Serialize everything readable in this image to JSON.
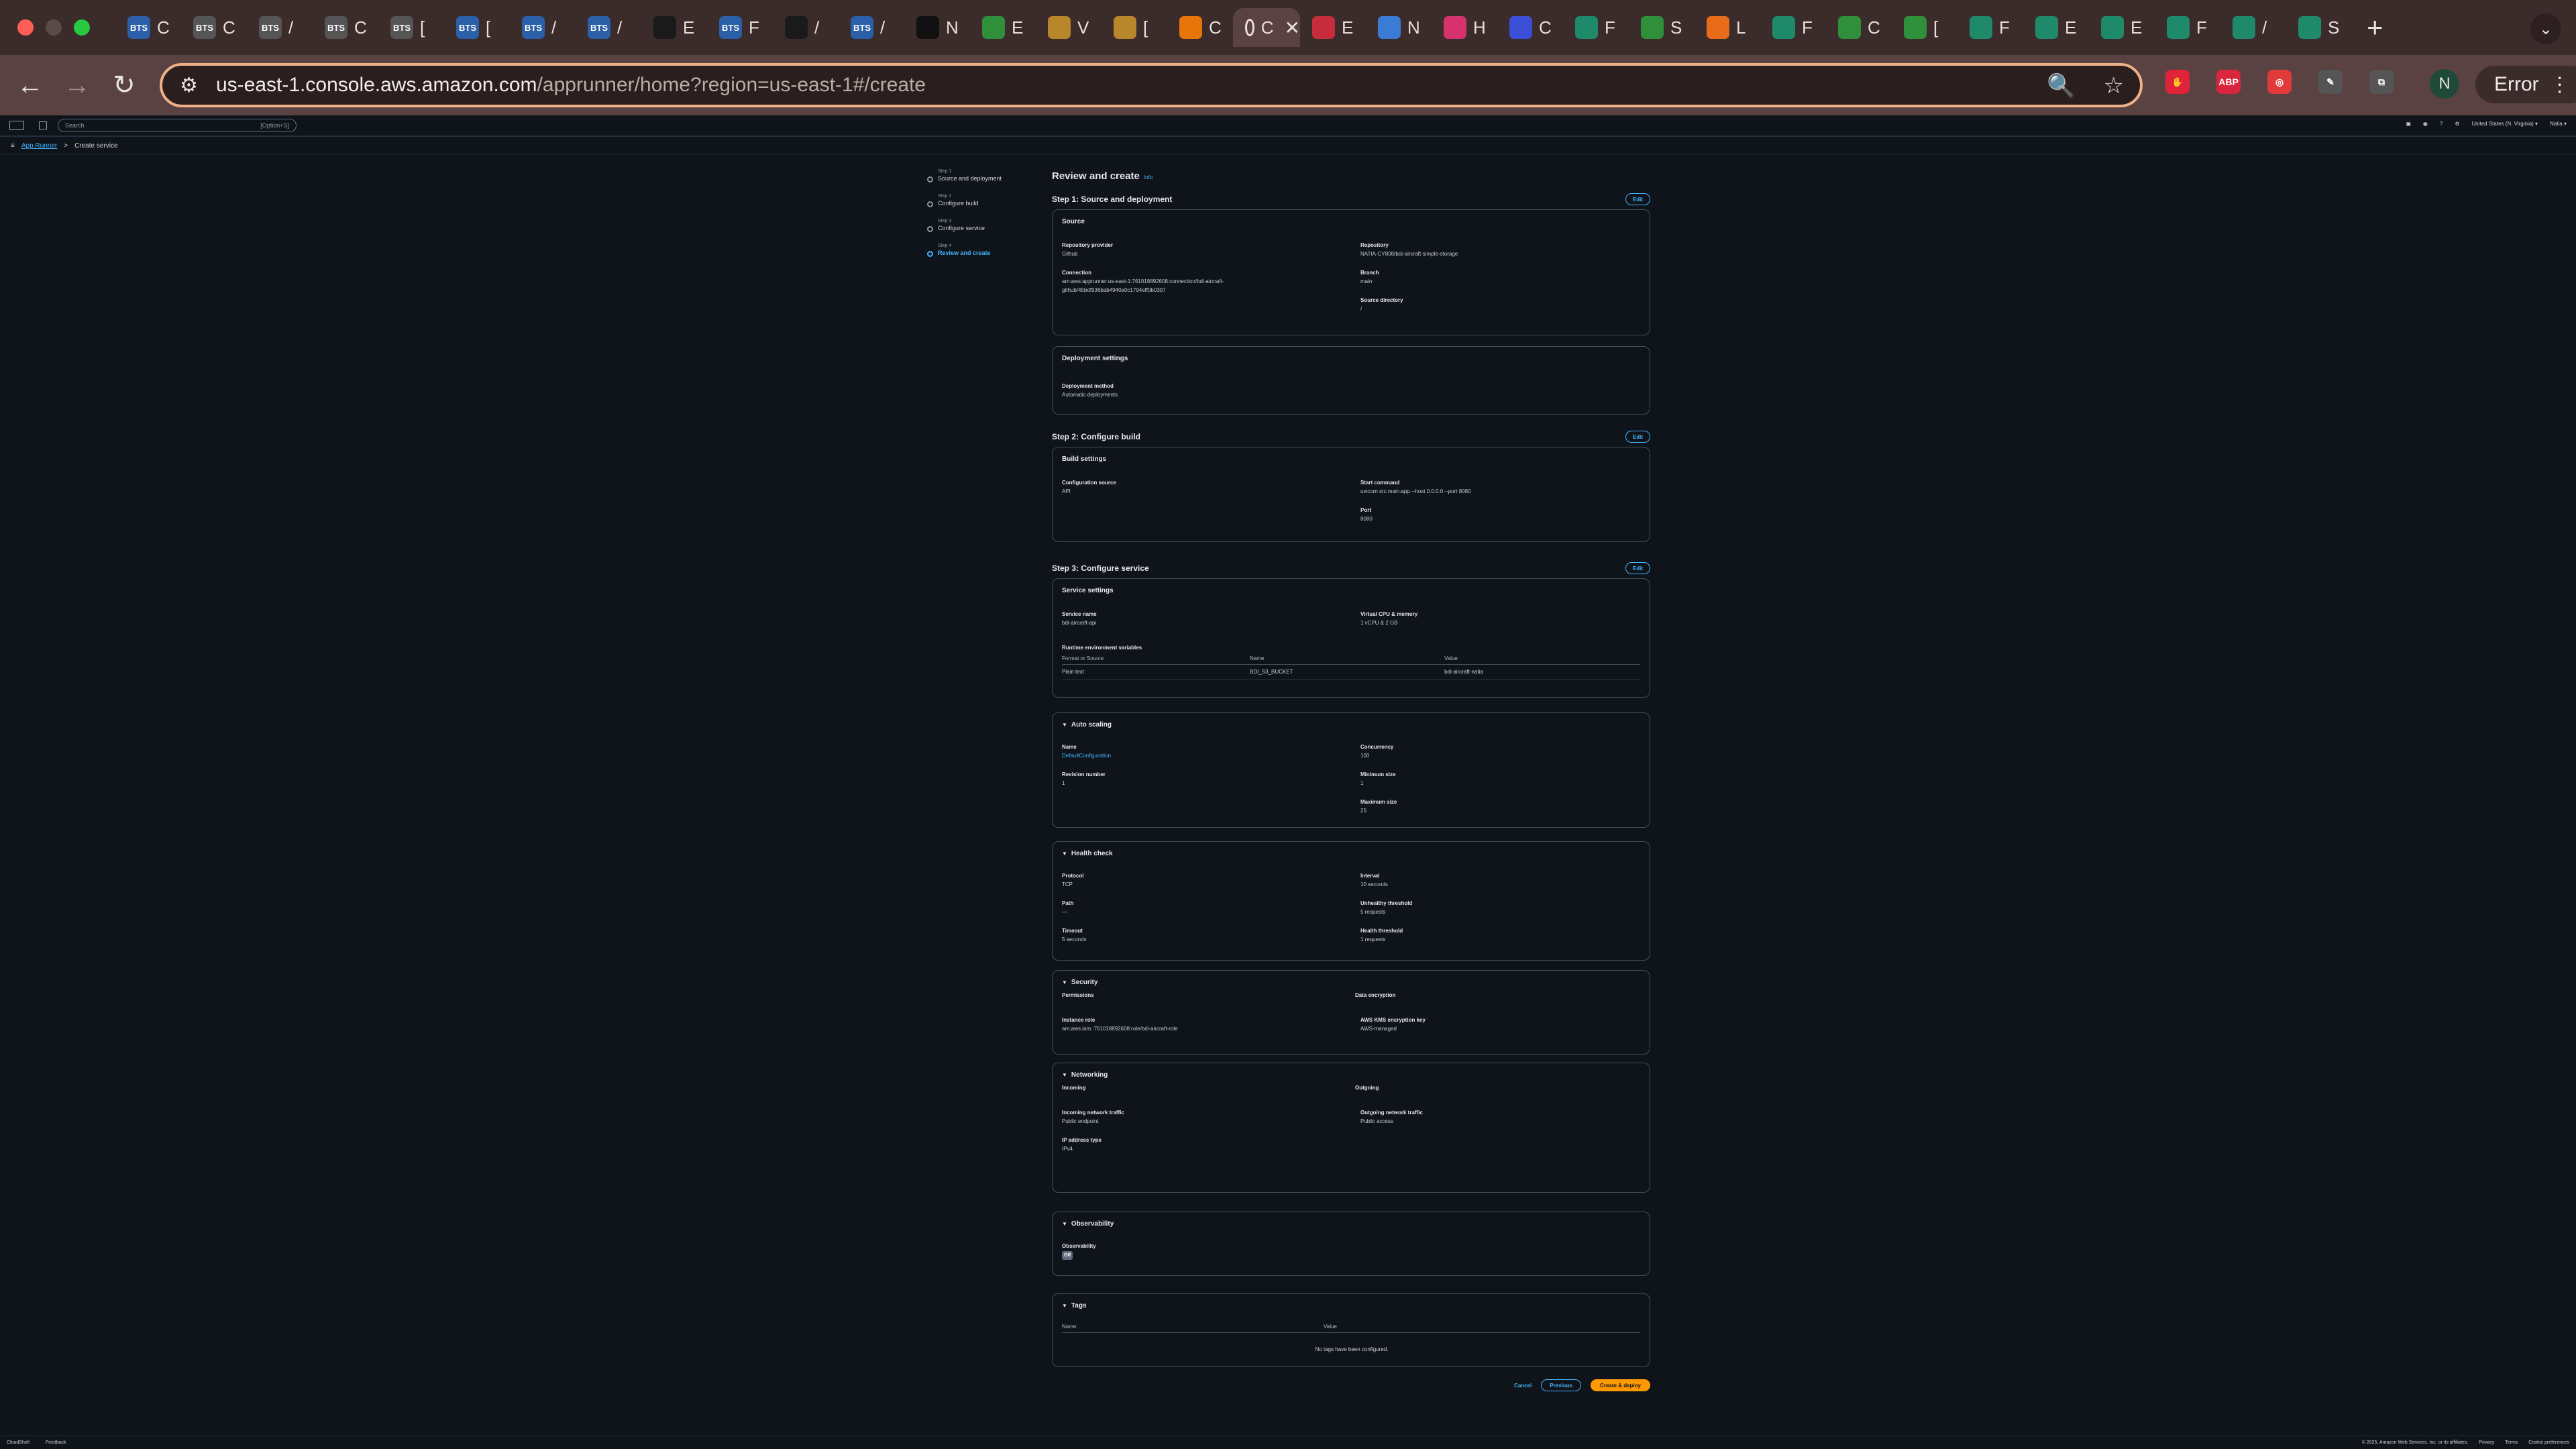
{
  "browser": {
    "active_tab_glyph": "C",
    "close_glyph": "✕",
    "new_tab_glyph": "+",
    "tab_menu_glyph": "⌄",
    "tabs": [
      {
        "icon": "bts-icon",
        "label": "C",
        "color": "#2b5fa8",
        "fav": "BTS"
      },
      {
        "icon": "bts-icon",
        "label": "C",
        "color": "#555555",
        "fav": "BTS"
      },
      {
        "icon": "bts-icon",
        "label": "/",
        "color": "#555555",
        "fav": "BTS"
      },
      {
        "icon": "bts-icon",
        "label": "C",
        "color": "#555555",
        "fav": "BTS"
      },
      {
        "icon": "bts-icon",
        "label": "[",
        "color": "#555555",
        "fav": "BTS"
      },
      {
        "icon": "bts-icon",
        "label": "[",
        "color": "#2b5fa8",
        "fav": "BTS"
      },
      {
        "icon": "bts-icon",
        "label": "/",
        "color": "#2b5fa8",
        "fav": "BTS"
      },
      {
        "icon": "bts-icon",
        "label": "/",
        "color": "#2b5fa8",
        "fav": "BTS"
      },
      {
        "icon": "circle-icon",
        "label": "E",
        "color": "#1a1a1a",
        "fav": ""
      },
      {
        "icon": "bts-icon",
        "label": "F",
        "color": "#2b5fa8",
        "fav": "BTS"
      },
      {
        "icon": "openai-icon",
        "label": "/",
        "color": "#1a1a1a",
        "fav": ""
      },
      {
        "icon": "bts-icon",
        "label": "/",
        "color": "#2b5fa8",
        "fav": "BTS"
      },
      {
        "icon": "github-icon",
        "label": "N",
        "color": "#111111",
        "fav": ""
      },
      {
        "icon": "green-box-icon",
        "label": "E",
        "color": "#2f8f3a",
        "fav": ""
      },
      {
        "icon": "package-icon",
        "label": "V",
        "color": "#b8862b",
        "fav": ""
      },
      {
        "icon": "package-icon",
        "label": "[",
        "color": "#b8862b",
        "fav": ""
      },
      {
        "icon": "aws-box-icon",
        "label": "C",
        "color": "#e8750a",
        "fav": ""
      },
      {
        "icon": "red-panel-icon",
        "label": "E",
        "color": "#c72c3c",
        "fav": ""
      },
      {
        "icon": "microsoft-icon",
        "label": "N",
        "color": "#3a7bd5",
        "fav": ""
      },
      {
        "icon": "pink-gear-icon",
        "label": "H",
        "color": "#d6336c",
        "fav": ""
      },
      {
        "icon": "blue-chip-icon",
        "label": "C",
        "color": "#3b4fd6",
        "fav": ""
      },
      {
        "icon": "leaf-icon",
        "label": "F",
        "color": "#1f8a6a",
        "fav": ""
      },
      {
        "icon": "green-box-icon",
        "label": "S",
        "color": "#2f8f3a",
        "fav": ""
      },
      {
        "icon": "orange-tool-icon",
        "label": "L",
        "color": "#e86b1a",
        "fav": ""
      },
      {
        "icon": "leaf-icon",
        "label": "F",
        "color": "#1f8a6a",
        "fav": ""
      },
      {
        "icon": "gfg-icon",
        "label": "C",
        "color": "#2f8f3a",
        "fav": ""
      },
      {
        "icon": "gfg-icon",
        "label": "[",
        "color": "#2f8f3a",
        "fav": ""
      },
      {
        "icon": "leaf-icon",
        "label": "F",
        "color": "#1f8a6a",
        "fav": ""
      },
      {
        "icon": "leaf-icon",
        "label": "E",
        "color": "#1f8a6a",
        "fav": ""
      },
      {
        "icon": "leaf-icon",
        "label": "E",
        "color": "#1f8a6a",
        "fav": ""
      },
      {
        "icon": "leaf-icon",
        "label": "F",
        "color": "#1f8a6a",
        "fav": ""
      },
      {
        "icon": "leaf-icon",
        "label": "/",
        "color": "#1f8a6a",
        "fav": ""
      },
      {
        "icon": "leaf-icon",
        "label": "S",
        "color": "#1f8a6a",
        "fav": ""
      }
    ],
    "url_host": "us-east-1.console.aws.amazon.com",
    "url_path": "/apprunner/home?region=us-east-1#/create",
    "avatar_letter": "N",
    "error_label": "Error",
    "nav": {
      "back": "←",
      "forward": "→",
      "reload": "↻",
      "tune": "⚙"
    },
    "omni_icons": {
      "zoom": "🔍",
      "bookmark": "☆"
    },
    "extensions": [
      {
        "icon": "hand-stop-icon",
        "color": "#e0233a",
        "glyph": "✋"
      },
      {
        "icon": "adblock-icon",
        "color": "#d9263c",
        "glyph": "ABP"
      },
      {
        "icon": "record-icon",
        "color": "#e03a3a",
        "glyph": "◎"
      },
      {
        "icon": "feather-icon",
        "color": "#555555",
        "glyph": "✎"
      },
      {
        "icon": "puzzle-icon",
        "color": "#555555",
        "glyph": "⧉"
      }
    ],
    "menu_glyph": "⋮"
  },
  "aws_nav": {
    "search_placeholder": "Search",
    "search_shortcut": "[Option+S]",
    "region": "United States (N. Virginia) ▾",
    "account": "Natia ▾"
  },
  "breadcrumb": {
    "root": "App Runner",
    "sep": ">",
    "current": "Create service"
  },
  "steps": [
    {
      "num": "Step 1",
      "label": "Source and deployment"
    },
    {
      "num": "Step 2",
      "label": "Configure build"
    },
    {
      "num": "Step 3",
      "label": "Configure service"
    },
    {
      "num": "Step 4",
      "label": "Review and create"
    }
  ],
  "page": {
    "title": "Review and create",
    "info": "Info",
    "edit": "Edit"
  },
  "step1": {
    "heading": "Step 1: Source and deployment",
    "source_title": "Source",
    "repo_provider_k": "Repository provider",
    "repo_provider_v": "Github",
    "connection_k": "Connection",
    "connection_v1": "arn:aws:apprunner:us-east-1:761018892608:connection/bdi-aircraft-",
    "connection_v2": "github/45bdf936bab4940a0c1794eff0b0397",
    "repository_k": "Repository",
    "repository_v": "NATIA-CY808/bdi-aircraft-simple-storage",
    "branch_k": "Branch",
    "branch_v": "main",
    "srcdir_k": "Source directory",
    "srcdir_v": "/",
    "deploy_title": "Deployment settings",
    "deploy_method_k": "Deployment method",
    "deploy_method_v": "Automatic deployments"
  },
  "step2": {
    "heading": "Step 2: Configure build",
    "build_title": "Build settings",
    "config_source_k": "Configuration source",
    "config_source_v": "API",
    "start_cmd_k": "Start command",
    "start_cmd_v": "uvicorn src.main:app --host 0.0.0.0 --port 8080",
    "port_k": "Port",
    "port_v": "8080"
  },
  "step3": {
    "heading": "Step 3: Configure service",
    "service_title": "Service settings",
    "service_name_k": "Service name",
    "service_name_v": "bdi-aircraft-api",
    "vcpu_k": "Virtual CPU & memory",
    "vcpu_v": "1 vCPU & 2 GB",
    "env_title": "Runtime environment variables",
    "env_headers": [
      "Format or Source",
      "Name",
      "Value"
    ],
    "env_rows": [
      [
        "Plain text",
        "BDI_S3_BUCKET",
        "bdi-aircraft-natia"
      ]
    ]
  },
  "autoscaling": {
    "title": "Auto scaling",
    "name_k": "Name",
    "name_v": "DefaultConfiguration",
    "revision_k": "Revision number",
    "revision_v": "1",
    "concurrency_k": "Concurrency",
    "concurrency_v": "100",
    "min_k": "Minimum size",
    "min_v": "1",
    "max_k": "Maximum size",
    "max_v": "25"
  },
  "health": {
    "title": "Health check",
    "protocol_k": "Protocol",
    "protocol_v": "TCP",
    "path_k": "Path",
    "path_v": "—",
    "timeout_k": "Timeout",
    "timeout_v": "5 seconds",
    "interval_k": "Interval",
    "interval_v": "10 seconds",
    "unhealthy_k": "Unhealthy threshold",
    "unhealthy_v": "5 requests",
    "healthy_k": "Health threshold",
    "healthy_v": "1 requests"
  },
  "security": {
    "title": "Security",
    "permissions": "Permissions",
    "data_encryption": "Data encryption",
    "instance_role_k": "Instance role",
    "instance_role_v": "arn:aws:iam::761018892608:role/bdi-aircraft-role",
    "kms_k": "AWS KMS encryption key",
    "kms_v": "AWS-managed"
  },
  "networking": {
    "title": "Networking",
    "incoming": "Incoming",
    "outgoing": "Outgoing",
    "in_traffic_k": "Incoming network traffic",
    "in_traffic_v": "Public endpoint",
    "ip_k": "IP address type",
    "ip_v": "IPv4",
    "out_traffic_k": "Outgoing network traffic",
    "out_traffic_v": "Public access"
  },
  "observability": {
    "title": "Observability",
    "k": "Observability",
    "v": "Off"
  },
  "tags": {
    "title": "Tags",
    "headers": [
      "Name",
      "Value"
    ],
    "empty": "No tags have been configured."
  },
  "actions": {
    "cancel": "Cancel",
    "previous": "Previous",
    "create": "Create & deploy"
  },
  "footer": {
    "cloudshell": "CloudShell",
    "feedback": "Feedback",
    "copyright": "© 2025, Amazon Web Services, Inc. or its affiliates.",
    "privacy": "Privacy",
    "terms": "Terms",
    "cookies": "Cookie preferences"
  },
  "triangle": "▼"
}
